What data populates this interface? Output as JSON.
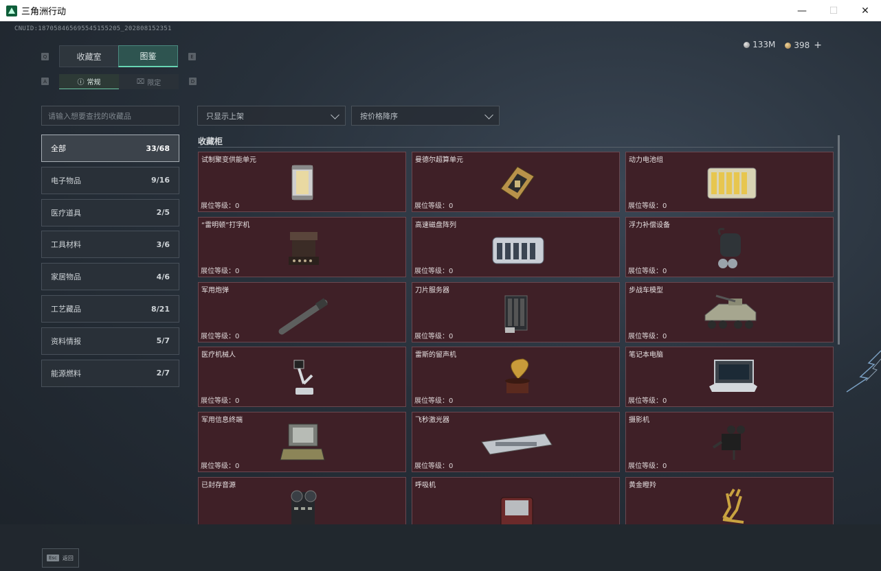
{
  "window": {
    "title": "三角洲行动",
    "minimize": "—",
    "maximize": "☐",
    "close": "✕"
  },
  "header": {
    "uid": "CNUID:187058465695545155205_202808152351",
    "currency_silver": "133M",
    "currency_gold": "398",
    "add_label": "+"
  },
  "tabs": {
    "key_left": "Q",
    "key_right": "E",
    "items": [
      {
        "label": "收藏室",
        "active": false
      },
      {
        "label": "图鉴",
        "active": true
      }
    ]
  },
  "subtabs": {
    "key_left": "A",
    "key_right": "D",
    "items": [
      {
        "label": "常规",
        "active": true
      },
      {
        "label": "限定",
        "active": false
      }
    ]
  },
  "search": {
    "placeholder": "请输入想要查找的收藏品"
  },
  "filters": {
    "display": "只显示上架",
    "sort": "按价格降序"
  },
  "categories": [
    {
      "label": "全部",
      "count": "33/68",
      "active": true
    },
    {
      "label": "电子物品",
      "count": "9/16",
      "active": false
    },
    {
      "label": "医疗道具",
      "count": "2/5",
      "active": false
    },
    {
      "label": "工具材料",
      "count": "3/6",
      "active": false
    },
    {
      "label": "家居物品",
      "count": "4/6",
      "active": false
    },
    {
      "label": "工艺藏品",
      "count": "8/21",
      "active": false
    },
    {
      "label": "资料情报",
      "count": "5/7",
      "active": false
    },
    {
      "label": "能源燃料",
      "count": "2/7",
      "active": false
    }
  ],
  "cabinet": {
    "title": "收藏柜",
    "items": [
      {
        "name": "试制聚变供能单元",
        "level": "展位等级：0",
        "icon": "fusion-unit-icon"
      },
      {
        "name": "曼德尔超算单元",
        "level": "展位等级：0",
        "icon": "supercomputer-chip-icon"
      },
      {
        "name": "动力电池组",
        "level": "展位等级：0",
        "icon": "battery-pack-icon"
      },
      {
        "name": "“雷明顿”打字机",
        "level": "展位等级：0",
        "icon": "typewriter-icon"
      },
      {
        "name": "高速磁盘阵列",
        "level": "展位等级：0",
        "icon": "disk-array-icon"
      },
      {
        "name": "浮力补偿设备",
        "level": "展位等级：0",
        "icon": "buoyancy-device-icon"
      },
      {
        "name": "军用炮弹",
        "level": "展位等级：0",
        "icon": "artillery-shell-icon"
      },
      {
        "name": "刀片服务器",
        "level": "展位等级：0",
        "icon": "blade-server-icon"
      },
      {
        "name": "步战车模型",
        "level": "展位等级：0",
        "icon": "ifv-model-icon"
      },
      {
        "name": "医疗机械人",
        "level": "展位等级：0",
        "icon": "medical-robot-icon"
      },
      {
        "name": "雷斯的留声机",
        "level": "展位等级：0",
        "icon": "gramophone-icon"
      },
      {
        "name": "笔记本电脑",
        "level": "展位等级：0",
        "icon": "laptop-icon"
      },
      {
        "name": "军用信息终端",
        "level": "展位等级：0",
        "icon": "military-terminal-icon"
      },
      {
        "name": "飞秒激光器",
        "level": "展位等级：0",
        "icon": "laser-device-icon"
      },
      {
        "name": "摄影机",
        "level": "展位等级：0",
        "icon": "film-camera-icon"
      },
      {
        "name": "已封存音源",
        "level": "",
        "icon": "reel-recorder-icon"
      },
      {
        "name": "呼吸机",
        "level": "",
        "icon": "ventilator-icon"
      },
      {
        "name": "黄金瞪羚",
        "level": "",
        "icon": "golden-gazelle-icon"
      }
    ]
  },
  "footer": {
    "esc_key": "Esc",
    "esc_label": "返回"
  },
  "colors": {
    "accent": "#68d6b4",
    "card_bg": "#3f2027",
    "card_border": "#6b4850"
  }
}
